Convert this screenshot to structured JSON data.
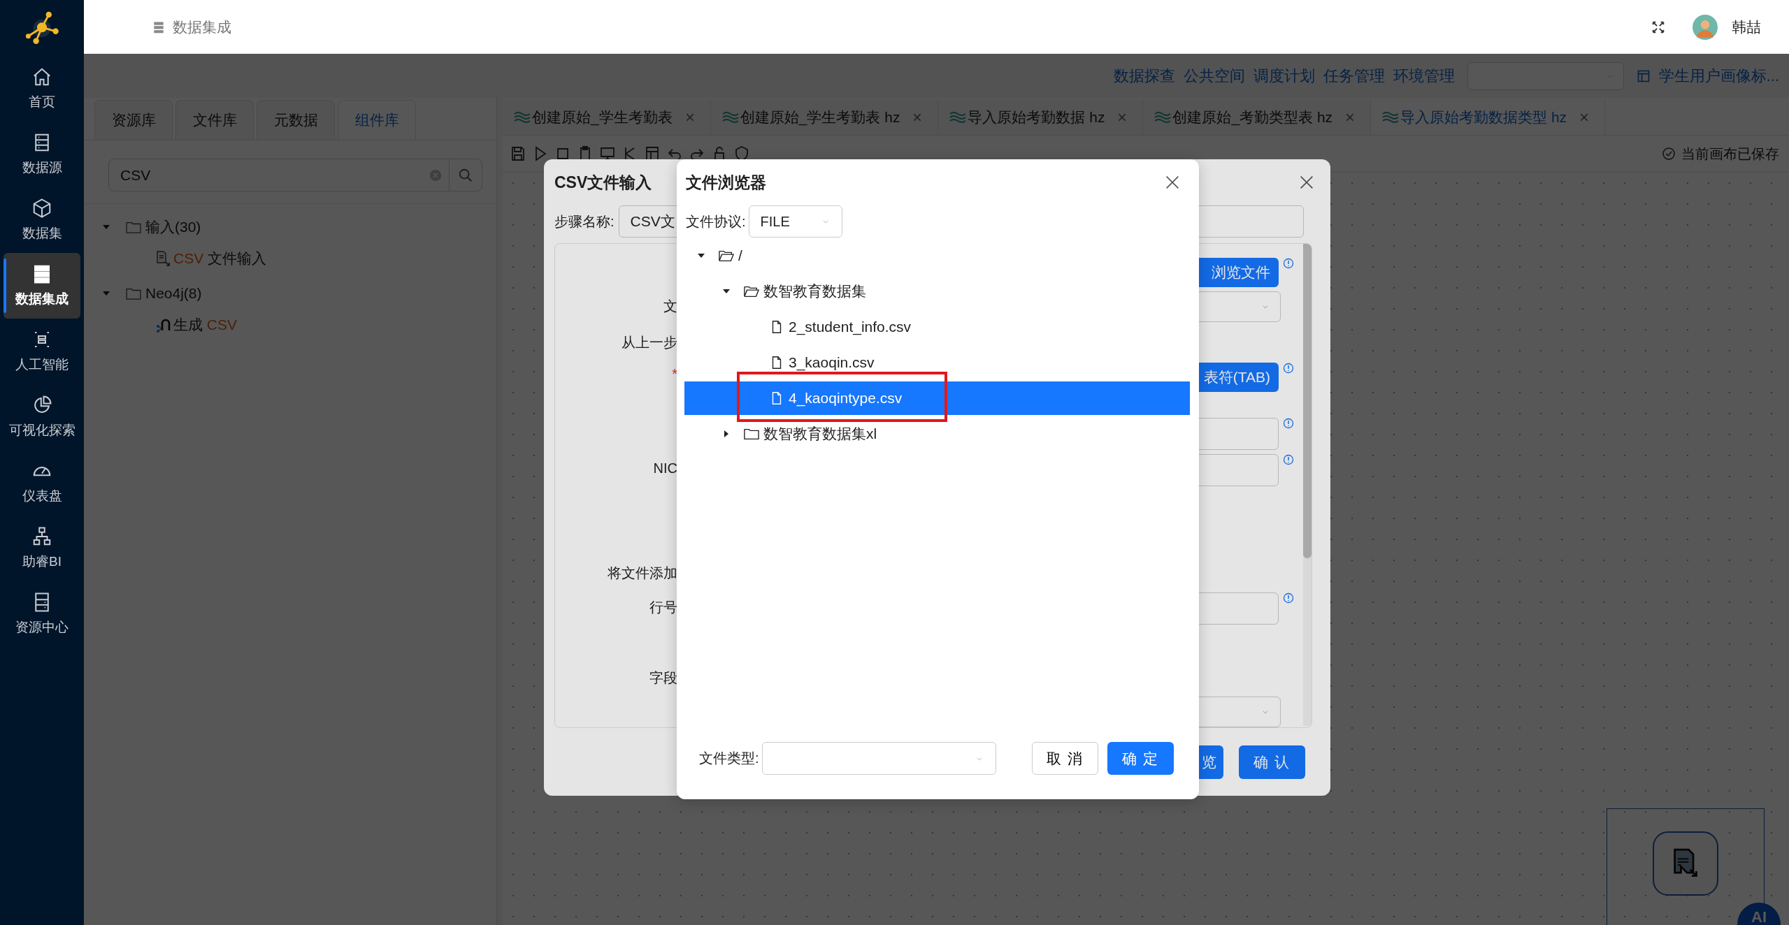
{
  "sidebar": {
    "items": [
      {
        "label": "首页",
        "selected": false
      },
      {
        "label": "数据源",
        "selected": false
      },
      {
        "label": "数据集",
        "selected": false
      },
      {
        "label": "数据集成",
        "selected": true
      },
      {
        "label": "人工智能",
        "selected": false
      },
      {
        "label": "可视化探索",
        "selected": false
      },
      {
        "label": "仪表盘",
        "selected": false
      },
      {
        "label": "助睿BI",
        "selected": false
      },
      {
        "label": "资源中心",
        "selected": false
      }
    ]
  },
  "header": {
    "title": "数据集成",
    "user": "韩喆"
  },
  "top_nav": {
    "links": [
      "数据探查",
      "公共空间",
      "调度计划",
      "任务管理",
      "环境管理"
    ],
    "project": "学生用户画像标..."
  },
  "left_panel": {
    "tabs": [
      {
        "label": "资源库",
        "selected": false
      },
      {
        "label": "文件库",
        "selected": false
      },
      {
        "label": "元数据",
        "selected": false
      },
      {
        "label": "组件库",
        "selected": true
      }
    ],
    "search": {
      "value": "CSV"
    },
    "tree": [
      {
        "label": "输入(30)",
        "expanded": true,
        "children": [
          {
            "kind": "csv-input",
            "parts": [
              {
                "text": "CSV",
                "match": true
              },
              {
                "text": " 文件输入",
                "match": false
              }
            ]
          }
        ]
      },
      {
        "label": "Neo4j(8)",
        "expanded": true,
        "children": [
          {
            "kind": "neo4j",
            "parts": [
              {
                "text": "生成 ",
                "match": false
              },
              {
                "text": "CSV",
                "match": true
              }
            ]
          }
        ]
      }
    ]
  },
  "editor_tabs": [
    {
      "label": "创建原始_学生考勤表",
      "selected": false
    },
    {
      "label": "创建原始_学生考勤表 hz",
      "selected": false
    },
    {
      "label": "导入原始考勤数据 hz",
      "selected": false
    },
    {
      "label": "创建原始_考勤类型表 hz",
      "selected": false
    },
    {
      "label": "导入原始考勤数据类型 hz",
      "selected": true
    }
  ],
  "save_status": "当前画布已保存",
  "csv_dialog": {
    "title": "CSV文件输入",
    "step_label": "步骤名称:",
    "step_value": "CSV文",
    "labels": [
      {
        "kind": "label",
        "text": "文"
      },
      {
        "kind": "label",
        "text": "从上一步"
      },
      {
        "kind": "required",
        "text": "*"
      },
      {
        "kind": "label",
        "text": "NIC"
      },
      {
        "kind": "label",
        "text": "将文件添加"
      },
      {
        "kind": "label",
        "text": "行号"
      },
      {
        "kind": "label",
        "text": "字段"
      }
    ],
    "controls": [
      {
        "kind": "button",
        "text": "浏览文件",
        "info": true
      },
      {
        "kind": "select",
        "info": false
      },
      {
        "kind": "button",
        "text": "表符(TAB)",
        "info": true
      },
      {
        "kind": "input",
        "info": true
      },
      {
        "kind": "input",
        "info": true
      },
      {
        "kind": "input",
        "info": true
      },
      {
        "kind": "select",
        "info": false
      }
    ],
    "buttons": [
      "览",
      "确 认"
    ]
  },
  "file_browser": {
    "title": "文件浏览器",
    "protocol_label": "文件协议:",
    "protocol": "FILE",
    "tree": [
      {
        "name": "/",
        "kind": "folder",
        "expanded": true,
        "selected": false,
        "children": [
          {
            "name": "数智教育数据集",
            "kind": "folder",
            "expanded": true,
            "selected": false,
            "children": [
              {
                "name": "2_student_info.csv",
                "kind": "file",
                "selected": false,
                "marked": false
              },
              {
                "name": "3_kaoqin.csv",
                "kind": "file",
                "selected": false,
                "marked": false
              },
              {
                "name": "4_kaoqintype.csv",
                "kind": "file",
                "selected": true,
                "marked": true
              }
            ]
          },
          {
            "name": "数智教育数据集xl",
            "kind": "folder",
            "expanded": false,
            "selected": false
          }
        ]
      }
    ],
    "type_label": "文件类型:",
    "cancel": "取 消",
    "ok": "确 定"
  },
  "canvas": {
    "ai_label": "AI"
  }
}
